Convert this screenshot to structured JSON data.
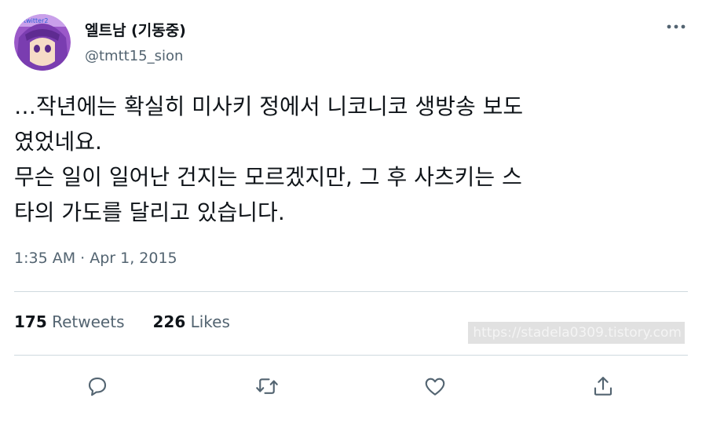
{
  "tweet": {
    "display_name": "엘트남 (기동중)",
    "handle": "@tmtt15_sion",
    "avatar_badge_text": "twitter2",
    "text": "…작년에는 확실히 미사키 정에서 니코니코 생방송 보도\n였었네요.\n무슨 일이 일어난 건지는 모르겠지만, 그 후 사츠키는 스\n타의 가도를 달리고 있습니다.",
    "timestamp": "1:35 AM · Apr 1, 2015"
  },
  "stats": {
    "retweets_count": "175",
    "retweets_label": "Retweets",
    "likes_count": "226",
    "likes_label": "Likes"
  },
  "watermark": "https://stadela0309.tistory.com",
  "actions": [
    "reply-icon",
    "retweet-icon",
    "like-icon",
    "share-icon"
  ],
  "colors": {
    "text_primary": "#0f1419",
    "text_secondary": "#536471",
    "divider": "#cfd9de",
    "icon": "#536471"
  }
}
